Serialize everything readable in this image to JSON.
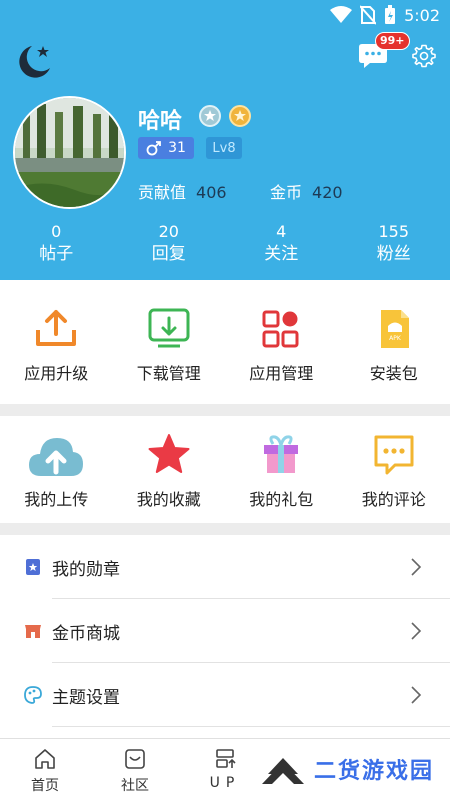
{
  "status_bar": {
    "time": "5:02"
  },
  "header": {
    "badge": "99+",
    "username": "哈哈",
    "gender_age": "31",
    "level": "Lv8",
    "contribution_label": "贡献值",
    "contribution_value": "406",
    "coins_label": "金币",
    "coins_value": "420"
  },
  "counts": [
    {
      "value": "0",
      "label": "帖子"
    },
    {
      "value": "20",
      "label": "回复"
    },
    {
      "value": "4",
      "label": "关注"
    },
    {
      "value": "155",
      "label": "粉丝"
    }
  ],
  "apps": [
    {
      "label": "应用升级",
      "icon": "upload-tray-icon"
    },
    {
      "label": "下载管理",
      "icon": "download-tray-icon"
    },
    {
      "label": "应用管理",
      "icon": "apps-grid-icon"
    },
    {
      "label": "安装包",
      "icon": "apk-file-icon"
    }
  ],
  "mine": [
    {
      "label": "我的上传",
      "icon": "cloud-upload-icon"
    },
    {
      "label": "我的收藏",
      "icon": "star-icon"
    },
    {
      "label": "我的礼包",
      "icon": "gift-icon"
    },
    {
      "label": "我的评论",
      "icon": "comment-icon"
    }
  ],
  "list": [
    {
      "label": "我的勋章",
      "icon": "medal-icon"
    },
    {
      "label": "金币商城",
      "icon": "shop-icon"
    },
    {
      "label": "主题设置",
      "icon": "palette-icon"
    }
  ],
  "nav": [
    {
      "label": "首页",
      "icon": "home-icon"
    },
    {
      "label": "社区",
      "icon": "community-icon"
    },
    {
      "label": "UP",
      "icon": "up-icon"
    }
  ],
  "watermark": "二货游戏园",
  "colors": {
    "header": "#3bb0e5",
    "badge": "#e5322d",
    "watermark": "#3a6fe8"
  }
}
